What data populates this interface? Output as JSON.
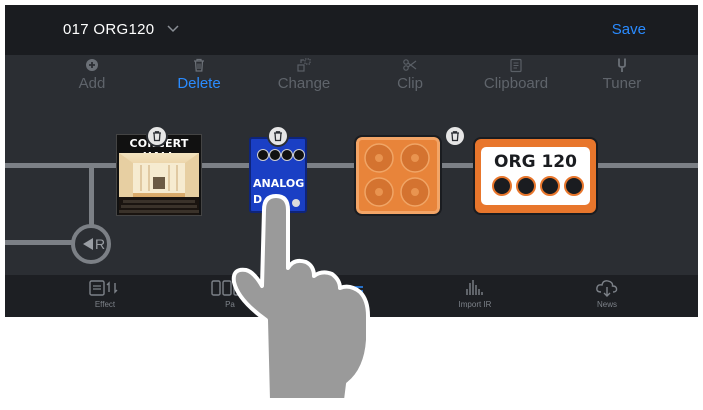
{
  "header": {
    "preset_name": "017 ORG120",
    "save_label": "Save"
  },
  "toolbar": {
    "items": [
      {
        "label": "Add",
        "icon": "plus-circle-icon"
      },
      {
        "label": "Delete",
        "icon": "trash-icon",
        "active": true
      },
      {
        "label": "Change",
        "icon": "swap-icon"
      },
      {
        "label": "Clip",
        "icon": "scissors-icon"
      },
      {
        "label": "Clipboard",
        "icon": "clipboard-icon"
      },
      {
        "label": "Tuner",
        "icon": "tuning-fork-icon"
      }
    ]
  },
  "chain": {
    "reverb": {
      "label": "CONCERT HALL"
    },
    "pedal": {
      "label_line1": "ANALOG",
      "label_line2": "D"
    },
    "amp": {
      "label": "ORG 120"
    },
    "return_label": "R"
  },
  "bottom_nav": {
    "items": [
      {
        "label": "Effect"
      },
      {
        "label": "Pa"
      },
      {
        "label": ""
      },
      {
        "label": "Import IR"
      },
      {
        "label": "News"
      }
    ]
  },
  "colors": {
    "accent": "#2a8bff",
    "amp_orange": "#e8762c",
    "cab_orange": "#e8843a",
    "pedal_blue": "#1a3fc4"
  }
}
